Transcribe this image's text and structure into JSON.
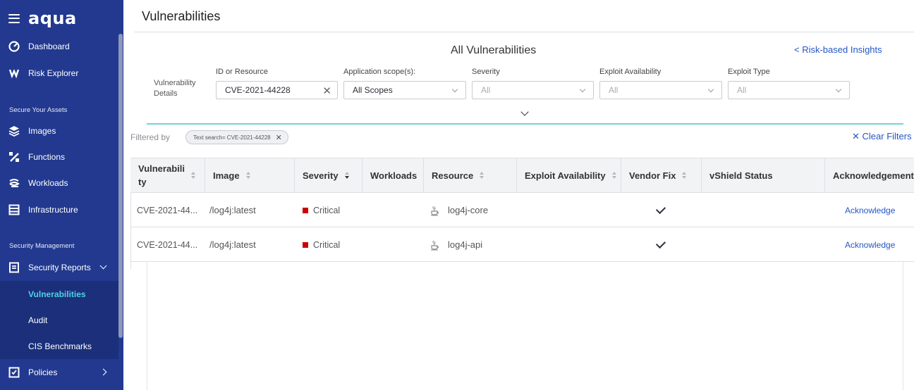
{
  "sidebar": {
    "brand": "aqua",
    "items_top": [
      {
        "label": "Dashboard",
        "icon": "dashboard-icon"
      },
      {
        "label": "Risk Explorer",
        "icon": "risk-explorer-icon"
      }
    ],
    "section1_title": "Secure Your Assets",
    "items_assets": [
      {
        "label": "Images",
        "icon": "images-icon"
      },
      {
        "label": "Functions",
        "icon": "functions-icon"
      },
      {
        "label": "Workloads",
        "icon": "workloads-icon"
      },
      {
        "label": "Infrastructure",
        "icon": "infrastructure-icon"
      }
    ],
    "section2_title": "Security Management",
    "security_reports": {
      "label": "Security Reports",
      "icon": "security-reports-icon"
    },
    "sub_items": [
      {
        "label": "Vulnerabilities",
        "active": true
      },
      {
        "label": "Audit",
        "active": false
      },
      {
        "label": "CIS Benchmarks",
        "active": false
      }
    ],
    "policies": {
      "label": "Policies",
      "icon": "policies-icon"
    }
  },
  "page": {
    "title": "Vulnerabilities",
    "subtitle": "All Vulnerabilities",
    "risk_link": "< Risk-based Insights"
  },
  "filters": {
    "section_label": "Vulnerability Details",
    "id_or_resource": {
      "label": "ID or Resource",
      "value": "CVE-2021-44228"
    },
    "app_scope": {
      "label": "Application scope(s):",
      "value": "All Scopes"
    },
    "severity": {
      "label": "Severity",
      "placeholder": "All"
    },
    "exploit_availability": {
      "label": "Exploit Availability",
      "placeholder": "All"
    },
    "exploit_type": {
      "label": "Exploit Type",
      "placeholder": "All"
    },
    "filtered_by": "Filtered by",
    "chip": "Text search= CVE-2021-44228",
    "clear_filters": "Clear Filters"
  },
  "table": {
    "headers": [
      "Vulnerabili ty",
      "Image",
      "Severity",
      "Workloads",
      "Resource",
      "Exploit Availability",
      "Vendor Fix",
      "vShield Status",
      "Acknowledgement"
    ],
    "header_line1": "Vulnerabili",
    "header_line2": "ty",
    "rows": [
      {
        "vulnerability": "CVE-2021-44...",
        "image": "/log4j:latest",
        "severity": "Critical",
        "resource": "log4j-core",
        "vendor_fix": true,
        "ack": "Acknowledge"
      },
      {
        "vulnerability": "CVE-2021-44...",
        "image": "/log4j:latest",
        "severity": "Critical",
        "resource": "log4j-api",
        "vendor_fix": true,
        "ack": "Acknowledge"
      }
    ]
  },
  "colors": {
    "sidebar_bg": "#22398f",
    "active_item": "#4fd2e6",
    "link": "#2457c5",
    "critical": "#cc0000",
    "accent_rule": "#70d3dc"
  }
}
